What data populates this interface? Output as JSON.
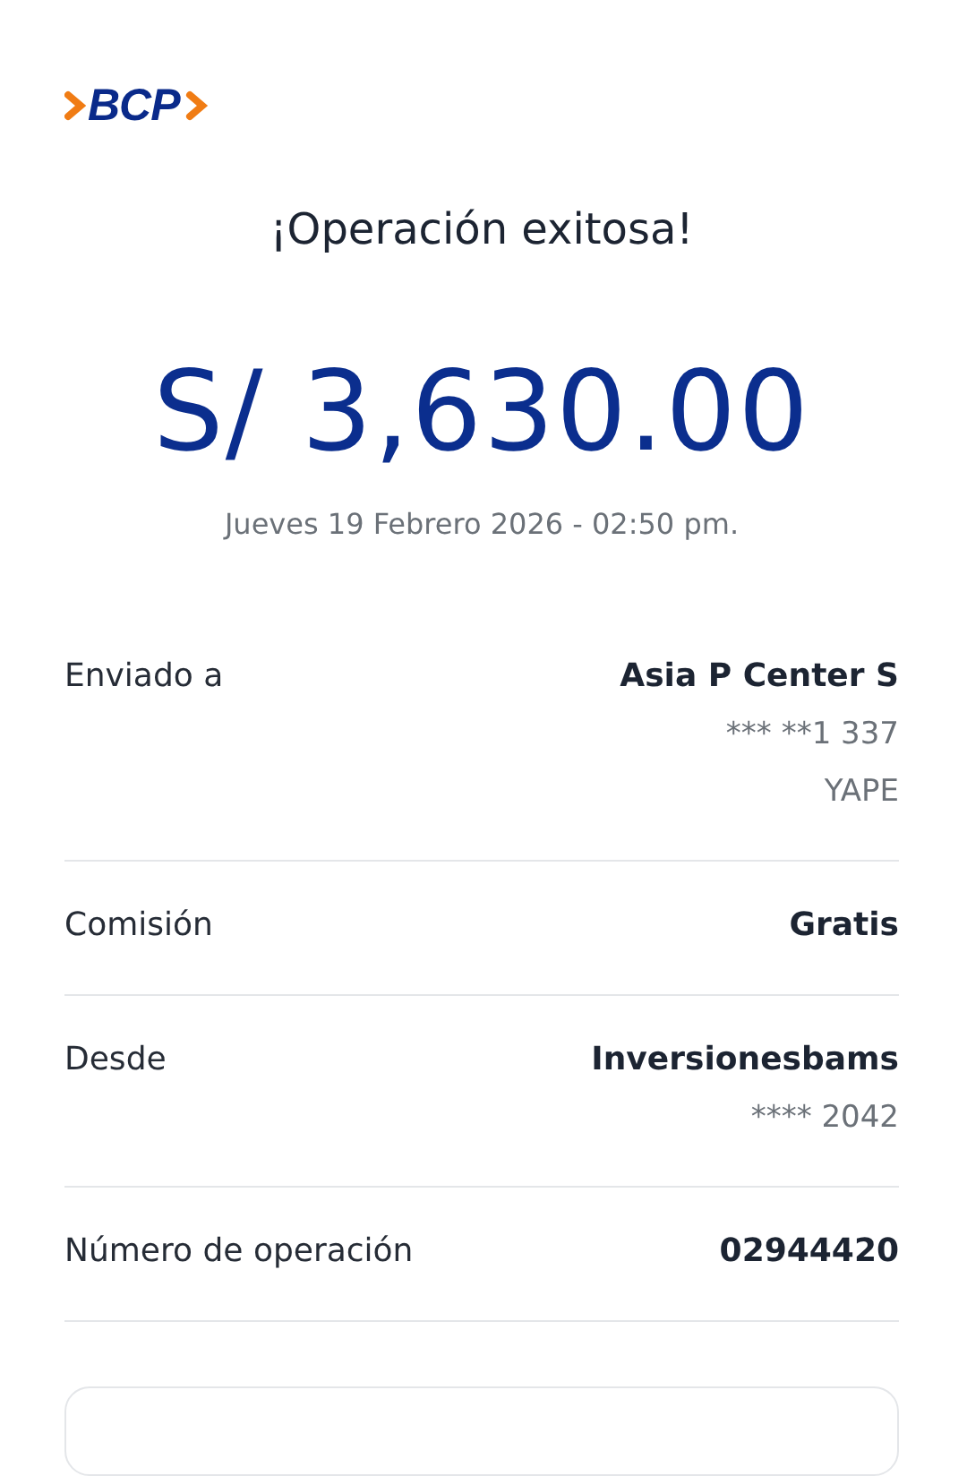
{
  "logo": {
    "text": "BCP"
  },
  "title": "¡Operación exitosa!",
  "amount": "S/ 3,630.00",
  "date": "Jueves 19 Febrero 2026 - 02:50 pm.",
  "details": [
    {
      "label": "Enviado a",
      "value": "Asia P Center S",
      "extra": [
        "*** **1 337",
        "YAPE"
      ]
    },
    {
      "label": "Comisión",
      "value": "Gratis"
    },
    {
      "label": "Desde",
      "value": "Inversionesbams",
      "extra": [
        "**** 2042"
      ]
    },
    {
      "label": "Número de operación",
      "value": "02944420"
    }
  ]
}
